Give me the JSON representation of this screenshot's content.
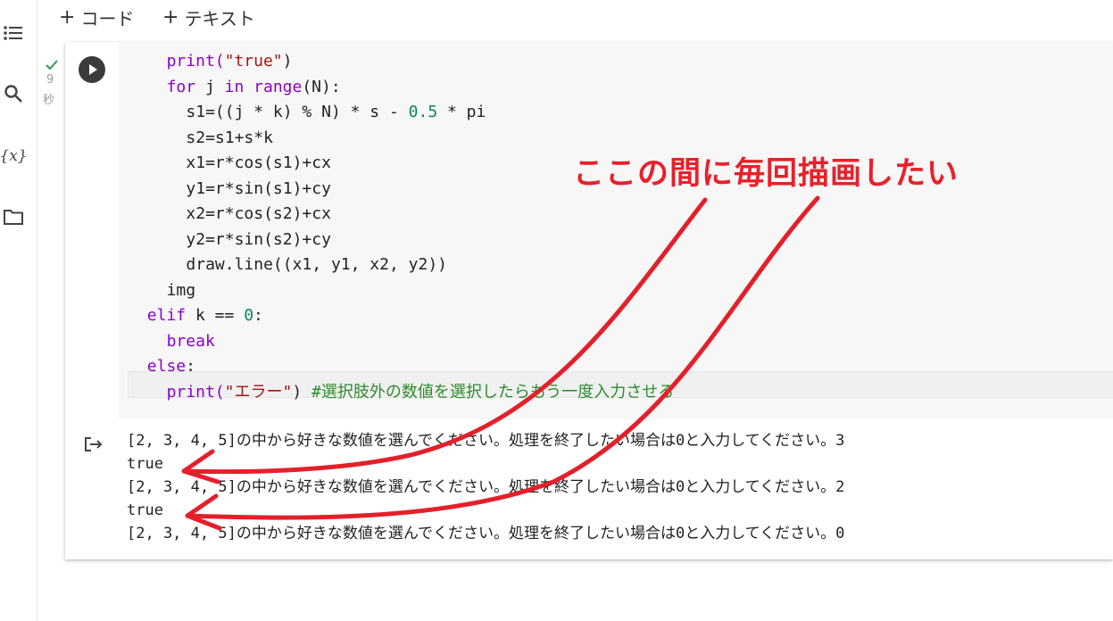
{
  "toolbar": {
    "add_code": "コード",
    "add_text": "テキスト",
    "plus": "+"
  },
  "sidebar": {
    "icons": [
      "toc-icon",
      "search-icon",
      "variables-icon",
      "folder-icon"
    ],
    "variables_glyph": "{x}"
  },
  "cell": {
    "exec_seconds": "9",
    "exec_unit": "秒",
    "code_lines": [
      {
        "indent": "    ",
        "parts": [
          {
            "t": "print(",
            "c": "kw"
          },
          {
            "t": "\"true\"",
            "c": "str"
          },
          {
            "t": ")",
            "c": ""
          }
        ]
      },
      {
        "indent": "    ",
        "parts": [
          {
            "t": "for",
            "c": "kw"
          },
          {
            "t": " j ",
            "c": ""
          },
          {
            "t": "in",
            "c": "kw"
          },
          {
            "t": " ",
            "c": ""
          },
          {
            "t": "range",
            "c": "kw"
          },
          {
            "t": "(N):",
            "c": ""
          }
        ]
      },
      {
        "indent": "      ",
        "parts": [
          {
            "t": "s1=((j * k) % N) * s - ",
            "c": ""
          },
          {
            "t": "0.5",
            "c": "num"
          },
          {
            "t": " * pi",
            "c": ""
          }
        ]
      },
      {
        "indent": "      ",
        "parts": [
          {
            "t": "s2=s1+s*k",
            "c": ""
          }
        ]
      },
      {
        "indent": "      ",
        "parts": [
          {
            "t": "x1=r*cos(s1)+cx",
            "c": ""
          }
        ]
      },
      {
        "indent": "      ",
        "parts": [
          {
            "t": "y1=r*sin(s1)+cy",
            "c": ""
          }
        ]
      },
      {
        "indent": "      ",
        "parts": [
          {
            "t": "x2=r*cos(s2)+cx",
            "c": ""
          }
        ]
      },
      {
        "indent": "      ",
        "parts": [
          {
            "t": "y2=r*sin(s2)+cy",
            "c": ""
          }
        ]
      },
      {
        "indent": "      ",
        "parts": [
          {
            "t": "draw.line((x1, y1, x2, y2))",
            "c": ""
          }
        ]
      },
      {
        "indent": "    ",
        "parts": [
          {
            "t": "img",
            "c": ""
          }
        ]
      },
      {
        "indent": "  ",
        "parts": [
          {
            "t": "elif",
            "c": "kw"
          },
          {
            "t": " k == ",
            "c": ""
          },
          {
            "t": "0",
            "c": "num"
          },
          {
            "t": ":",
            "c": ""
          }
        ]
      },
      {
        "indent": "    ",
        "parts": [
          {
            "t": "break",
            "c": "kw"
          }
        ]
      },
      {
        "indent": "  ",
        "parts": [
          {
            "t": "else",
            "c": "kw"
          },
          {
            "t": ":",
            "c": ""
          }
        ]
      },
      {
        "indent": "    ",
        "parts": [
          {
            "t": "print(",
            "c": "kw"
          },
          {
            "t": "\"エラー\"",
            "c": "str"
          },
          {
            "t": ") ",
            "c": ""
          },
          {
            "t": "#選択肢外の数値を選択したらもう一度入力させる",
            "c": "cm"
          }
        ]
      }
    ]
  },
  "output": {
    "lines": [
      "[2, 3, 4, 5]の中から好きな数値を選んでください。処理を終了したい場合は0と入力してください。3",
      "true",
      "[2, 3, 4, 5]の中から好きな数値を選んでください。処理を終了したい場合は0と入力してください。2",
      "true",
      "[2, 3, 4, 5]の中から好きな数値を選んでください。処理を終了したい場合は0と入力してください。0"
    ]
  },
  "annotation": {
    "text": "ここの間に毎回描画したい",
    "color": "#e8202a"
  }
}
